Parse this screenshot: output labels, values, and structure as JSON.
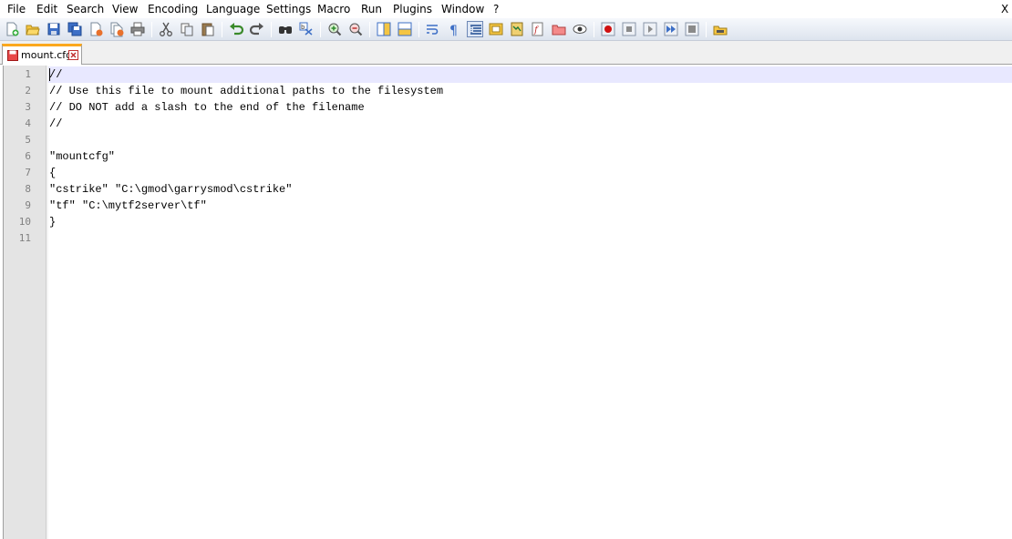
{
  "menu": {
    "items": [
      "File",
      "Edit",
      "Search",
      "View",
      "Encoding",
      "Language",
      "Settings",
      "Macro",
      "Run",
      "Plugins",
      "Window",
      "?"
    ],
    "close_label": "X"
  },
  "toolbar": {
    "icons": [
      "new-file-icon",
      "open-file-icon",
      "save-icon",
      "save-all-icon",
      "close-icon",
      "close-all-icon",
      "print-icon",
      "cut-icon",
      "copy-icon",
      "paste-icon",
      "undo-icon",
      "redo-icon",
      "find-icon",
      "replace-icon",
      "zoom-in-icon",
      "zoom-out-icon",
      "sync-vertical-icon",
      "sync-horizontal-icon",
      "word-wrap-icon",
      "show-all-characters-icon",
      "indent-guide-icon",
      "user-defined-language-icon",
      "document-map-icon",
      "function-list-icon",
      "folder-as-workspace-icon",
      "monitoring-icon",
      "record-macro-icon",
      "stop-recording-icon",
      "playback-macro-icon",
      "run-macro-multiple-icon",
      "save-macro-icon",
      "launch-icon"
    ]
  },
  "tabs": [
    {
      "label": "mount.cfg",
      "active": true
    }
  ],
  "editor": {
    "line_numbers": [
      "1",
      "2",
      "3",
      "4",
      "5",
      "6",
      "7",
      "8",
      "9",
      "10",
      "11"
    ],
    "lines": [
      "//",
      "// Use this file to mount additional paths to the filesystem",
      "// DO NOT add a slash to the end of the filename",
      "//",
      "",
      "\"mountcfg\"",
      "{",
      "\"cstrike\" \"C:\\gmod\\garrysmod\\cstrike\"",
      "\"tf\" \"C:\\mytf2server\\tf\"",
      "}",
      ""
    ],
    "current_line": 1
  },
  "colors": {
    "current_line_bg": "#e8e8ff",
    "gutter_bg": "#e4e4e4",
    "tab_accent": "#fba81d",
    "line_number_fg": "#808080"
  }
}
